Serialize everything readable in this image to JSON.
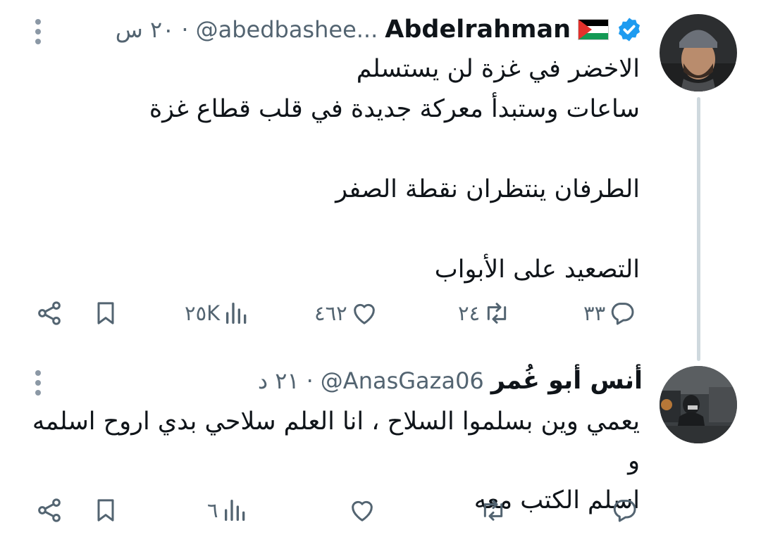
{
  "tweets": [
    {
      "name": "Abdelrahman",
      "handle": "@abedbashee...",
      "dot": "·",
      "time": "٢٠ س",
      "lines": [
        "الاخضر في غزة لن يستسلم",
        "ساعات وستبدأ معركة جديدة في قلب قطاع غزة",
        "",
        "الطرفان ينتظران نقطة الصفر",
        "",
        "التصعيد على الأبواب"
      ],
      "stats": {
        "views": "٢٥K",
        "likes": "٤٦٢",
        "retweets": "٢٤",
        "replies": "٣٣"
      },
      "icons": {
        "flag": "palestine-flag-icon",
        "verified": "verified-badge-icon"
      }
    },
    {
      "name": "أنس أبو غُمر",
      "handle": "@AnasGaza06",
      "dot": "·",
      "time": "٢١ د",
      "lines": [
        "يعمي وين بسلموا السلاح ، انا العلم سلاحي بدي اروح اسلمه و",
        "اسلم الكتب معه"
      ],
      "stats": {
        "views": "٦",
        "likes": "",
        "retweets": "",
        "replies": ""
      }
    }
  ],
  "colors": {
    "text": "#0f1419",
    "muted": "#536471",
    "verified": "#1d9bf0",
    "thread_line": "#cfd9de"
  }
}
